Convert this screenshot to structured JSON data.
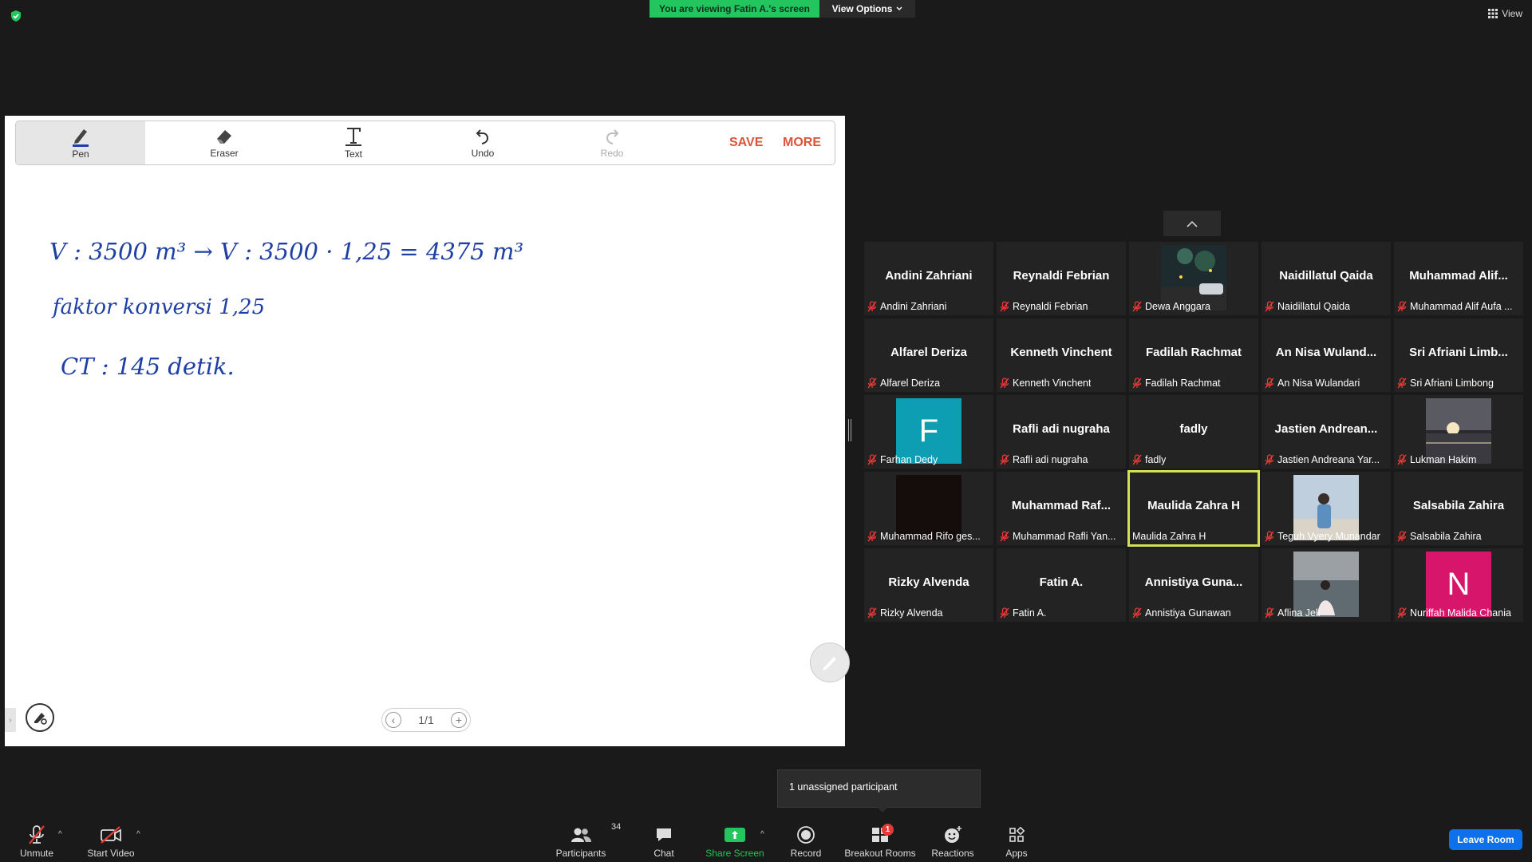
{
  "top": {
    "banner": "You are viewing Fatin A.'s screen",
    "view_options": "View Options",
    "view": "View"
  },
  "whiteboard": {
    "tools": {
      "pen": "Pen",
      "eraser": "Eraser",
      "text": "Text",
      "undo": "Undo",
      "redo": "Redo"
    },
    "save": "SAVE",
    "more": "MORE",
    "handwriting": [
      "V : 3500 m³ → V : 3500 · 1,25 = 4375 m³",
      "faktor konversi 1,25",
      "CT : 145 detik."
    ],
    "page": "1/1"
  },
  "participants": [
    {
      "title": "Andini Zahriani",
      "name": "Andini Zahriani",
      "video": "none"
    },
    {
      "title": "Reynaldi Febrian",
      "name": "Reynaldi Febrian",
      "video": "none"
    },
    {
      "title": "",
      "name": "Dewa Anggara",
      "video": "night-street-photo"
    },
    {
      "title": "Naidillatul Qaida",
      "name": "Naidillatul Qaida",
      "video": "none"
    },
    {
      "title": "Muhammad Alif...",
      "name": "Muhammad Alif Aufa ...",
      "video": "none"
    },
    {
      "title": "Alfarel Deriza",
      "name": "Alfarel Deriza",
      "video": "none"
    },
    {
      "title": "Kenneth Vinchent",
      "name": "Kenneth Vinchent",
      "video": "none"
    },
    {
      "title": "Fadilah Rachmat",
      "name": "Fadilah Rachmat",
      "video": "none"
    },
    {
      "title": "An Nisa Wuland...",
      "name": "An Nisa Wulandari",
      "video": "none"
    },
    {
      "title": "Sri Afriani Limb...",
      "name": "Sri Afriani Limbong",
      "video": "none"
    },
    {
      "title": "",
      "name": "Farhan Dedy",
      "video": "avatar-letter",
      "letter": "F",
      "color": "#0e9eb3"
    },
    {
      "title": "Rafli adi nugraha",
      "name": "Rafli adi nugraha",
      "video": "none"
    },
    {
      "title": "fadly",
      "name": "fadly",
      "video": "none"
    },
    {
      "title": "Jastien Andrean...",
      "name": "Jastien Andreana Yar...",
      "video": "none"
    },
    {
      "title": "",
      "name": "Lukman Hakim",
      "video": "sunset-photo"
    },
    {
      "title": "",
      "name": "Muhammad Rifo ges...",
      "video": "dark-video"
    },
    {
      "title": "Muhammad Raf...",
      "name": "Muhammad Rafli Yan...",
      "video": "none"
    },
    {
      "title": "Maulida Zahra H",
      "name": "Maulida Zahra H",
      "video": "none",
      "active": true
    },
    {
      "title": "",
      "name": "Teguh Vyery Munandar",
      "video": "person-photo"
    },
    {
      "title": "Salsabila Zahira",
      "name": "Salsabila Zahira",
      "video": "none"
    },
    {
      "title": "Rizky Alvenda",
      "name": "Rizky Alvenda",
      "video": "none"
    },
    {
      "title": "Fatin A.",
      "name": "Fatin A.",
      "video": "none"
    },
    {
      "title": "Annistiya Guna...",
      "name": "Annistiya Gunawan",
      "video": "none"
    },
    {
      "title": "",
      "name": "Aflina Jeli",
      "video": "sea-photo"
    },
    {
      "title": "",
      "name": "Nuriffah Malida Chania",
      "video": "avatar-letter",
      "letter": "N",
      "color": "#d6156b"
    }
  ],
  "toast": "1 unassigned participant",
  "toolbar": {
    "unmute": "Unmute",
    "start_video": "Start Video",
    "participants": "Participants",
    "participants_count": "34",
    "chat": "Chat",
    "share_screen": "Share Screen",
    "record": "Record",
    "breakout_rooms": "Breakout Rooms",
    "breakout_badge": "1",
    "reactions": "Reactions",
    "apps": "Apps",
    "leave": "Leave Room"
  },
  "colors": {
    "banner": "#23c55e",
    "active_border": "#d4e157",
    "leave": "#0e71eb",
    "whiteboard_action": "#e0513a",
    "ink": "#1f3fa5"
  }
}
